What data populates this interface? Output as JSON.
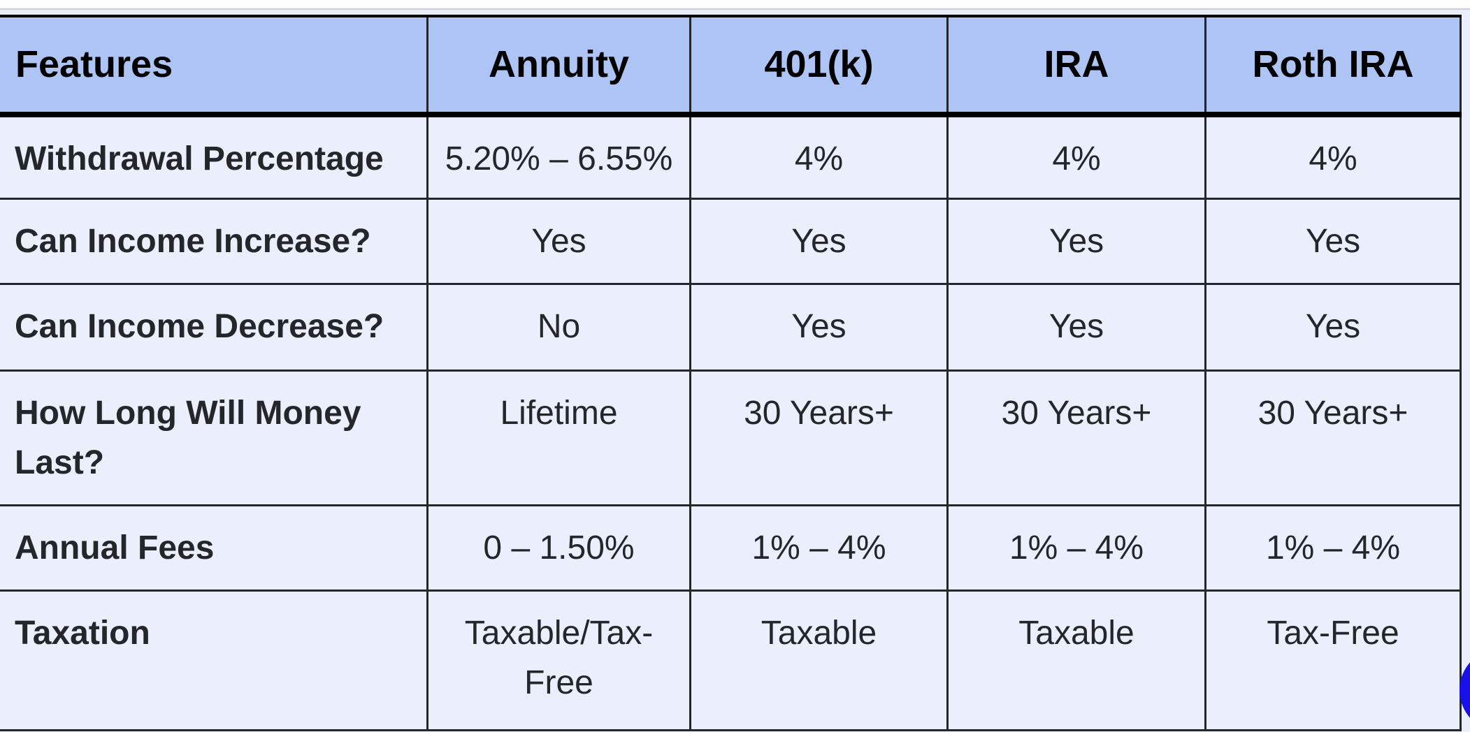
{
  "table": {
    "headers": [
      "Features",
      "Annuity",
      "401(k)",
      "IRA",
      "Roth IRA"
    ],
    "rows": [
      [
        "Withdrawal Percentage",
        "5.20% – 6.55%",
        "4%",
        "4%",
        "4%"
      ],
      [
        "Can Income Increase?",
        "Yes",
        "Yes",
        "Yes",
        "Yes"
      ],
      [
        "Can Income Decrease?",
        "No",
        "Yes",
        "Yes",
        "Yes"
      ],
      [
        "How Long Will Money Last?",
        "Lifetime",
        "30 Years+",
        "30 Years+",
        "30 Years+"
      ],
      [
        "Annual Fees",
        "0 – 1.50%",
        "1% – 4%",
        "1% – 4%",
        "1% – 4%"
      ],
      [
        "Taxation",
        "Taxable/Tax-Free",
        "Taxable",
        "Taxable",
        "Tax-Free"
      ]
    ]
  },
  "colors": {
    "header_bg": "#aec4f5",
    "body_bg": "#eaeffb",
    "floating_button": "#1a10e8"
  },
  "floating_button_icon": "circle-button"
}
